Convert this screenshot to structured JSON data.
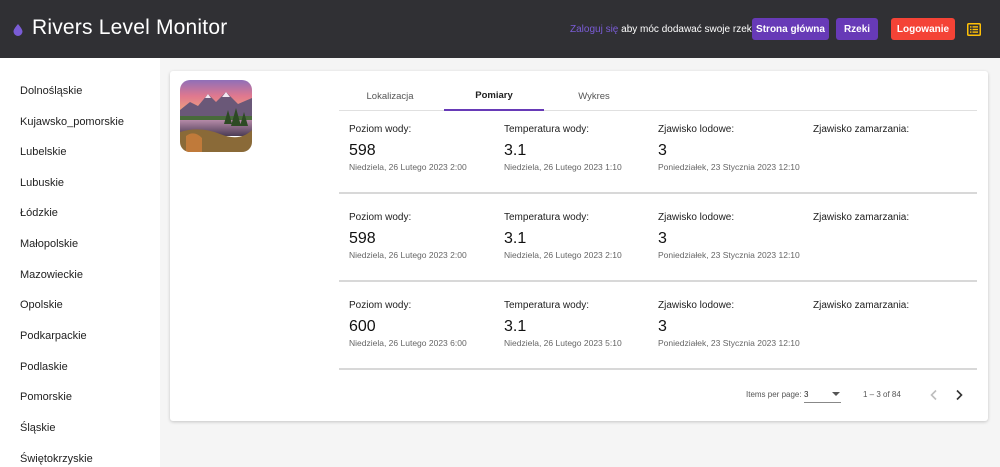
{
  "header": {
    "title": "Rivers Level Monitor",
    "login_link": "Zaloguj się",
    "login_hint": " aby móc dodawać swoje rzeki",
    "home_button": "Strona główna",
    "rivers_button": "Rzeki",
    "login_button": "Logowanie",
    "accent_color": "#673ab7",
    "login_color": "#f44336",
    "menu_icon_color": "#ffc107"
  },
  "sidebar": {
    "items": [
      {
        "label": "Dolnośląskie"
      },
      {
        "label": "Kujawsko_pomorskie"
      },
      {
        "label": "Lubelskie"
      },
      {
        "label": "Lubuskie"
      },
      {
        "label": "Łódzkie"
      },
      {
        "label": "Małopolskie"
      },
      {
        "label": "Mazowieckie"
      },
      {
        "label": "Opolskie"
      },
      {
        "label": "Podkarpackie"
      },
      {
        "label": "Podlaskie"
      },
      {
        "label": "Pomorskie"
      },
      {
        "label": "Śląskie"
      },
      {
        "label": "Świętokrzyskie"
      }
    ]
  },
  "tabs": [
    {
      "label": "Lokalizacja"
    },
    {
      "label": "Pomiary"
    },
    {
      "label": "Wykres"
    }
  ],
  "measurements": [
    {
      "water_level": {
        "label": "Poziom wody:",
        "value": "598",
        "date": "Niedziela, 26 Lutego 2023 2:00"
      },
      "water_temp": {
        "label": "Temperatura wody:",
        "value": "3.1",
        "date": "Niedziela, 26 Lutego 2023 1:10"
      },
      "ice": {
        "label": "Zjawisko lodowe:",
        "value": "3",
        "date": "Poniedziałek, 23 Stycznia 2023 12:10"
      },
      "freeze": {
        "label": "Zjawisko zamarzania:"
      }
    },
    {
      "water_level": {
        "label": "Poziom wody:",
        "value": "598",
        "date": "Niedziela, 26 Lutego 2023 2:00"
      },
      "water_temp": {
        "label": "Temperatura wody:",
        "value": "3.1",
        "date": "Niedziela, 26 Lutego 2023 2:10"
      },
      "ice": {
        "label": "Zjawisko lodowe:",
        "value": "3",
        "date": "Poniedziałek, 23 Stycznia 2023 12:10"
      },
      "freeze": {
        "label": "Zjawisko zamarzania:"
      }
    },
    {
      "water_level": {
        "label": "Poziom wody:",
        "value": "600",
        "date": "Niedziela, 26 Lutego 2023 6:00"
      },
      "water_temp": {
        "label": "Temperatura wody:",
        "value": "3.1",
        "date": "Niedziela, 26 Lutego 2023 5:10"
      },
      "ice": {
        "label": "Zjawisko lodowe:",
        "value": "3",
        "date": "Poniedziałek, 23 Stycznia 2023 12:10"
      },
      "freeze": {
        "label": "Zjawisko zamarzania:"
      }
    }
  ],
  "paginator": {
    "items_per_page_label": "Items per page:",
    "page_size": "3",
    "range": "1 – 3 of 84"
  },
  "icons": {
    "logo": "water-drop-icon",
    "menu": "list-menu-icon",
    "prev": "chevron-left-icon",
    "next": "chevron-right-icon"
  }
}
